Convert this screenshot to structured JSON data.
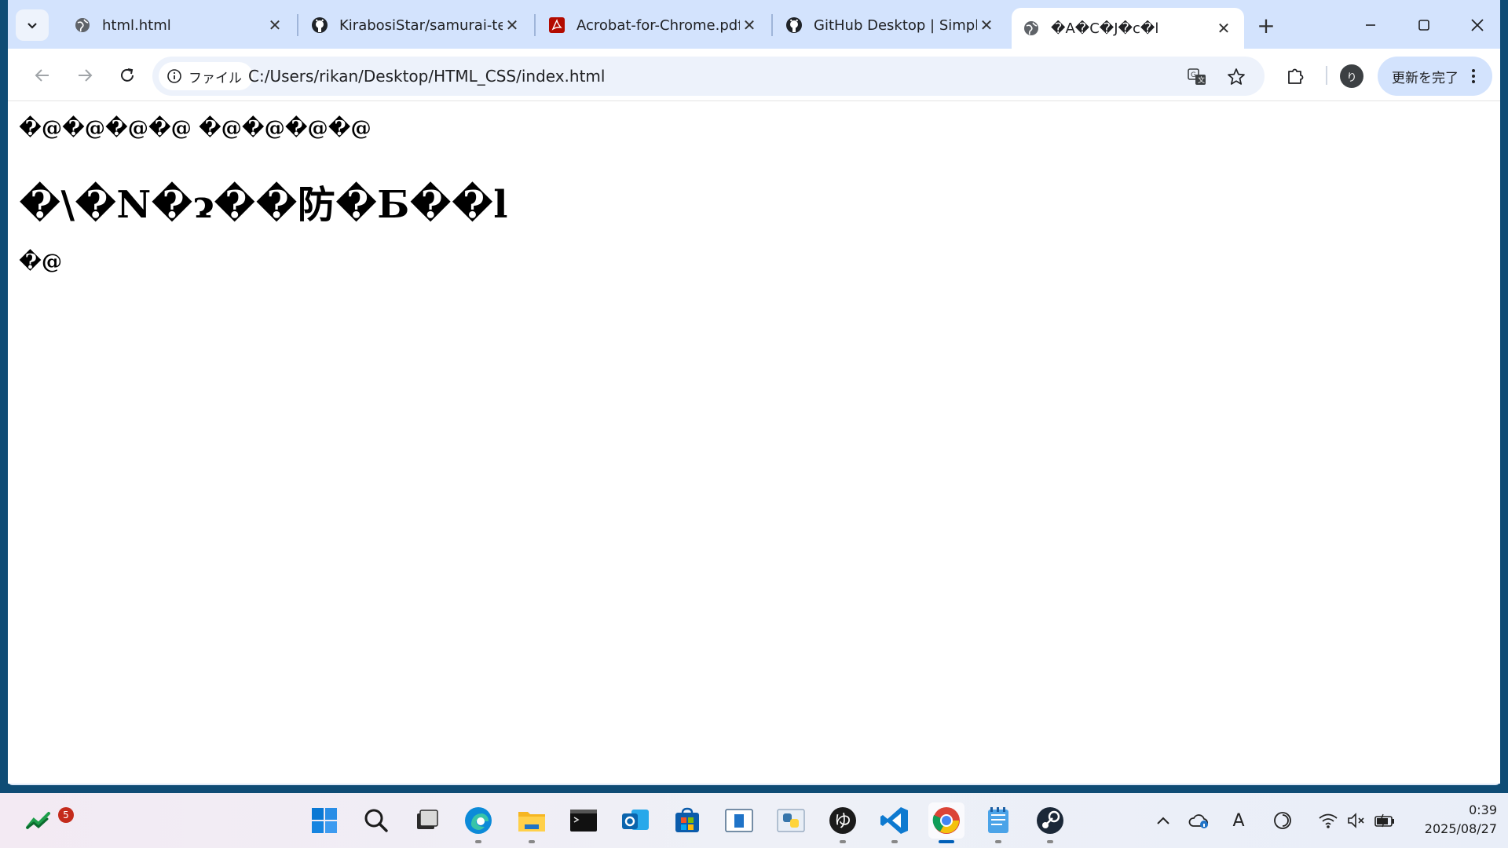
{
  "browser": {
    "tabs": [
      {
        "title": "html.html",
        "icon": "globe-icon"
      },
      {
        "title": "KirabosiStar/samurai-ter",
        "icon": "github-icon"
      },
      {
        "title": "Acrobat-for-Chrome.pdf",
        "icon": "acrobat-icon"
      },
      {
        "title": "GitHub Desktop | Simple",
        "icon": "github-icon"
      },
      {
        "title": "�A�C�J�c�l",
        "icon": "globe-icon",
        "active": true
      }
    ],
    "new_tab_label": "+",
    "site_chip_label": "ファイル",
    "url": "C:/Users/rikan/Desktop/HTML_CSS/index.html",
    "profile_initial": "り",
    "update_button_label": "更新を完了"
  },
  "page": {
    "line1": "�@�@�@�@ �@�@�@�@",
    "heading": "�\\�N�ɂ��防�Б��l",
    "line2": "�@"
  },
  "taskbar": {
    "widgets_badge": "5",
    "time": "0:39",
    "date": "2025/08/27",
    "ime_label": "A"
  },
  "colors": {
    "tabstrip": "#d3e3fd",
    "accent": "#005fb8",
    "acrobat_red": "#b30b00"
  }
}
